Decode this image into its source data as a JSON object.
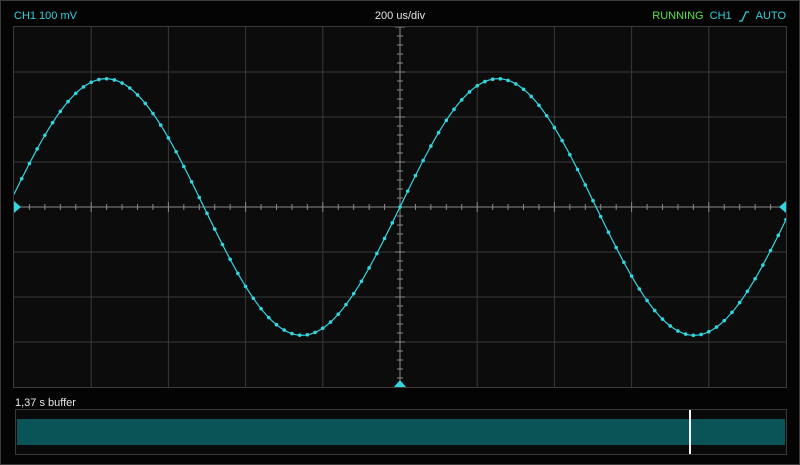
{
  "header": {
    "channel_scale": "CH1 100 mV",
    "timebase": "200 us/div",
    "run_status": "RUNNING",
    "trigger_source": "CH1",
    "trigger_edge_icon": "rising-edge-icon",
    "trigger_mode": "AUTO"
  },
  "buffer": {
    "label": "1,37 s buffer",
    "position": 0.874
  },
  "colors": {
    "trace": "#33d6e0",
    "buffer_fill": "#0a5356",
    "running": "#55e23c",
    "grid": "#3a3a3a"
  },
  "chart_data": {
    "type": "line",
    "x_divisions": 10,
    "y_divisions": 8,
    "xlim_div": [
      -5,
      5
    ],
    "ylim_div": [
      -4,
      4
    ],
    "grid": true,
    "series": [
      {
        "waveform": "sine",
        "amplitude_div": 2.85,
        "period_div": 5.08,
        "phase_zero_div": 0.0,
        "sample_step_div": 0.1
      }
    ],
    "markers": {
      "trigger_level_div": 0,
      "trigger_time_div": 0
    }
  }
}
